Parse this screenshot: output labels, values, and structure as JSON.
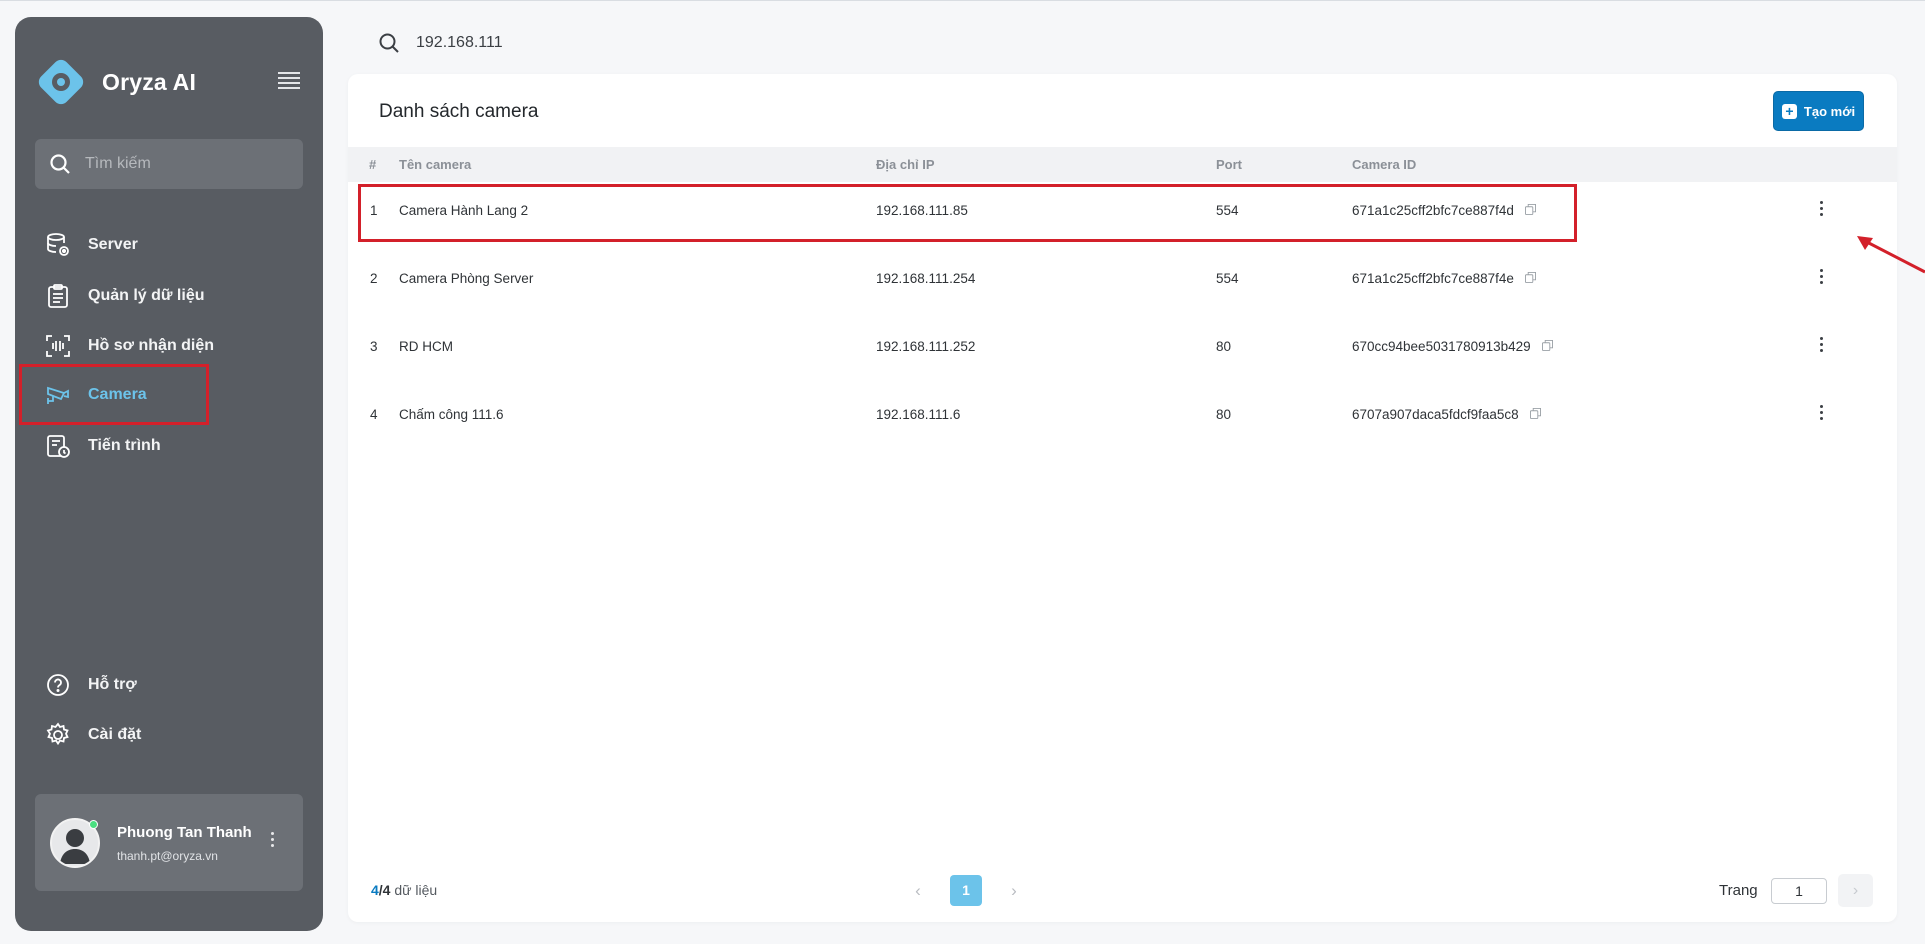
{
  "brand": {
    "name": "Oryza AI"
  },
  "sidebar": {
    "search_placeholder": "Tìm kiếm",
    "items": [
      {
        "label": "Server",
        "icon": "server-icon"
      },
      {
        "label": "Quản lý dữ liệu",
        "icon": "clipboard-list-icon"
      },
      {
        "label": "Hồ sơ nhận diện",
        "icon": "face-scan-icon"
      },
      {
        "label": "Camera",
        "icon": "camera-icon",
        "active": true
      },
      {
        "label": "Tiến trình",
        "icon": "process-clock-icon"
      }
    ],
    "bottom_items": [
      {
        "label": "Hỗ trợ",
        "icon": "help-circle-icon"
      },
      {
        "label": "Cài đặt",
        "icon": "gear-icon"
      }
    ],
    "user": {
      "name": "Phuong Tan Thanh",
      "email": "thanh.pt@oryza.vn",
      "status": "online"
    }
  },
  "top_search": {
    "value": "192.168.111"
  },
  "main": {
    "title": "Danh sách camera",
    "create_label": "Tạo mới",
    "columns": [
      "#",
      "Tên camera",
      "Địa chỉ IP",
      "Port",
      "Camera ID"
    ],
    "rows": [
      {
        "index": "1",
        "name": "Camera Hành Lang 2",
        "ip": "192.168.111.85",
        "port": "554",
        "camera_id": "671a1c25cff2bfc7ce887f4d"
      },
      {
        "index": "2",
        "name": "Camera Phòng Server",
        "ip": "192.168.111.254",
        "port": "554",
        "camera_id": "671a1c25cff2bfc7ce887f4e"
      },
      {
        "index": "3",
        "name": "RD HCM",
        "ip": "192.168.111.252",
        "port": "80",
        "camera_id": "670cc94bee5031780913b429"
      },
      {
        "index": "4",
        "name": "Chấm công 111.6",
        "ip": "192.168.111.6",
        "port": "80",
        "camera_id": "6707a907daca5fdcf9faa5c8"
      }
    ],
    "footer": {
      "count_current": "4",
      "count_total": "/4",
      "count_suffix": " dữ liệu",
      "current_page": "1",
      "page_label": "Trang",
      "page_input": "1"
    }
  },
  "colors": {
    "sidebar_bg": "#585c62",
    "accent": "#6cc3ea",
    "primary_button": "#0a7bc1",
    "highlight": "#d3202a"
  }
}
